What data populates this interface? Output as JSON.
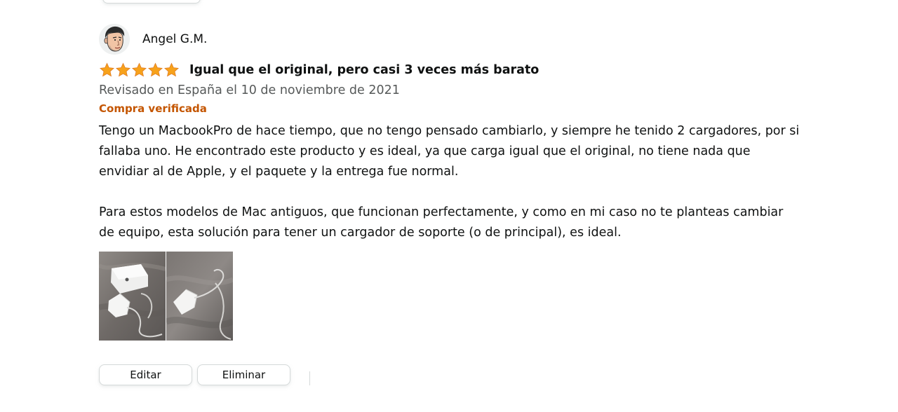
{
  "review": {
    "profile_name": "Angel G.M.",
    "rating_stars": 5,
    "rating_max": 5,
    "title": "Igual que el original, pero casi 3 veces más barato",
    "date": "Revisado en España el 10 de noviembre de 2021",
    "verified_label": "Compra verificada",
    "body_paragraphs": [
      "Tengo un MacbookPro de hace tiempo, que no tengo pensado cambiarlo, y siempre he tenido 2 cargadores, por si fallaba uno. He encontrado este producto y es ideal, ya que carga igual que el original, no tiene nada que envidiar al de Apple, y el paquete y la entrega fue normal.",
      "Para estos modelos de Mac antiguos, que funcionan perfectamente, y como en mi caso no te planteas cambiar de equipo, esta solución para tener un cargador de soporte (o de principal), es ideal."
    ],
    "image_count": 2
  },
  "actions": {
    "edit_label": "Editar",
    "delete_label": "Eliminar"
  },
  "colors": {
    "star": "#f7a21b",
    "verified": "#c45500",
    "date": "#565959",
    "text": "#0f1111",
    "button_border": "#d5d9d9"
  },
  "icons": {
    "avatar": "avatar-icon",
    "star": "star-icon"
  }
}
